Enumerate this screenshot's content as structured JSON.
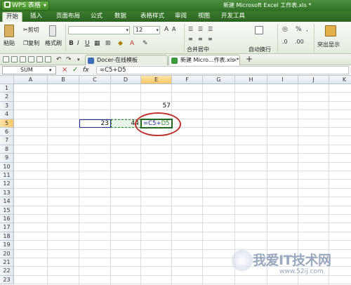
{
  "app": {
    "name": "WPS 表格",
    "window_title": "新建 Microsoft Excel 工作表.xls *",
    "accent": "#3b7a2c"
  },
  "menu": {
    "tabs": [
      "开始",
      "插入",
      "页面布局",
      "公式",
      "数据",
      "表格样式",
      "审阅",
      "视图",
      "开发工具"
    ],
    "active": "开始"
  },
  "ribbon": {
    "paste": "粘贴",
    "cut": "剪切",
    "copy": "复制",
    "format_painter": "格式刷",
    "font_size": "12",
    "merge_center": "合并居中",
    "wrap_text": "自动换行",
    "percent": "%",
    "thousands": ",",
    "highlight": "突出显示"
  },
  "doc_tabs": [
    {
      "label": "Docer-在线模板",
      "active": false
    },
    {
      "label": "新建 Micro...作表.xls *",
      "active": true
    }
  ],
  "formula_bar": {
    "name_box": "SUM",
    "cancel": "×",
    "confirm": "✓",
    "fx": "fx",
    "formula": "=C5+D5"
  },
  "grid": {
    "columns": [
      "A",
      "B",
      "C",
      "D",
      "E",
      "F",
      "G",
      "H",
      "I",
      "J",
      "K"
    ],
    "rows": [
      "1",
      "2",
      "3",
      "4",
      "5",
      "6",
      "7",
      "8",
      "9",
      "10",
      "11",
      "12",
      "13",
      "14",
      "15",
      "16",
      "17",
      "18",
      "19",
      "20",
      "21",
      "22",
      "23"
    ],
    "selected_column": "E",
    "selected_row": "5",
    "cells": {
      "E3": "57",
      "C5": "23",
      "D5": "44",
      "E5_editing": "=C5+",
      "E5_ref": "D5"
    }
  },
  "watermark": {
    "text": "我爱IT技术网",
    "sub": "www.52ij.com"
  }
}
